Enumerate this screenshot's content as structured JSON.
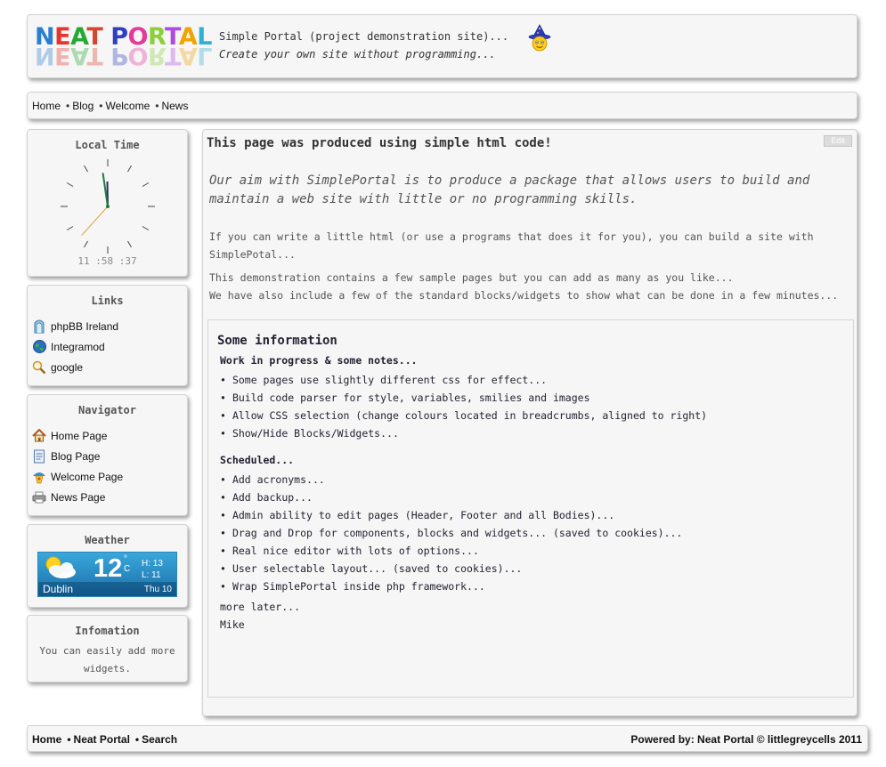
{
  "header": {
    "logo_text": "NEAT PORTAL",
    "logo_colors": [
      "#2a7fd0",
      "#e8342c",
      "#27a834",
      "#d7452e",
      "#2f3fbf",
      "#e33a9b",
      "#8ccf39",
      "#b04ae0",
      "#f0a400",
      "#2fb1d6"
    ],
    "site_title": "Simple Portal (project demonstration site)...",
    "tagline": "Create your own site without programming...",
    "mascot_icon": "wizard-smiley-icon"
  },
  "topnav": {
    "items": [
      "Home",
      "Blog",
      "Welcome",
      "News"
    ]
  },
  "clock": {
    "title": "Local Time",
    "digital": "11 :58 :37",
    "hours": 11,
    "minutes": 58,
    "seconds": 37
  },
  "links": {
    "title": "Links",
    "items": [
      {
        "label": "phpBB Ireland",
        "icon": "phpbb-icon"
      },
      {
        "label": "Integramod",
        "icon": "globe-icon"
      },
      {
        "label": "google",
        "icon": "magnifier-icon"
      }
    ]
  },
  "navigator": {
    "title": "Navigator",
    "items": [
      {
        "label": "Home Page",
        "icon": "house-icon"
      },
      {
        "label": "Blog Page",
        "icon": "document-icon"
      },
      {
        "label": "Welcome Page",
        "icon": "welcome-icon"
      },
      {
        "label": "News Page",
        "icon": "printer-icon"
      }
    ]
  },
  "weather": {
    "title": "Weather",
    "temp": "12",
    "unit": "°\nC",
    "high": "H: 13",
    "low": "L: 11",
    "city": "Dublin",
    "day": "Thu 10",
    "icon": "sun-cloud-icon"
  },
  "infomation": {
    "title": "Infomation",
    "text": "You can easily add more widgets."
  },
  "main": {
    "edit_label": "Edit",
    "heading": "This page was produced using simple html code!",
    "aim": "Our aim with SimplePortal is to produce a package that allows users to build and maintain a web site with little or no programming skills.",
    "p1": "If you can write a little html (or use a programs that does it for you), you can build a site with SimplePotal...",
    "p2": "This demonstration contains a few sample pages but you can add as many as you like...",
    "p3": "We have also include a few of the standard blocks/widgets to show what can be done in a few minutes...",
    "info_heading": "Some information",
    "sub1": "Work in progress & some notes...",
    "list1": [
      "Some pages use slightly different css for effect...",
      "Build code parser for style, variables, smilies and images",
      "Allow CSS selection (change colours located in breadcrumbs, aligned to right)",
      "Show/Hide Blocks/Widgets..."
    ],
    "sub2": "Scheduled...",
    "list2": [
      "Add acronyms...",
      "Add backup...",
      "Admin ability to edit pages (Header, Footer and all Bodies)...",
      "Drag and Drop for components, blocks and widgets... (saved to cookies)...",
      "Real nice editor with lots of options...",
      "User selectable layout... (saved to cookies)...",
      "Wrap SimplePortal inside php framework..."
    ],
    "more_later": "more later...",
    "signature": "Mike"
  },
  "footer": {
    "items": [
      "Home",
      "Neat Portal",
      "Search"
    ],
    "credit": "Powered by: Neat Portal © littlegreycells 2011"
  }
}
